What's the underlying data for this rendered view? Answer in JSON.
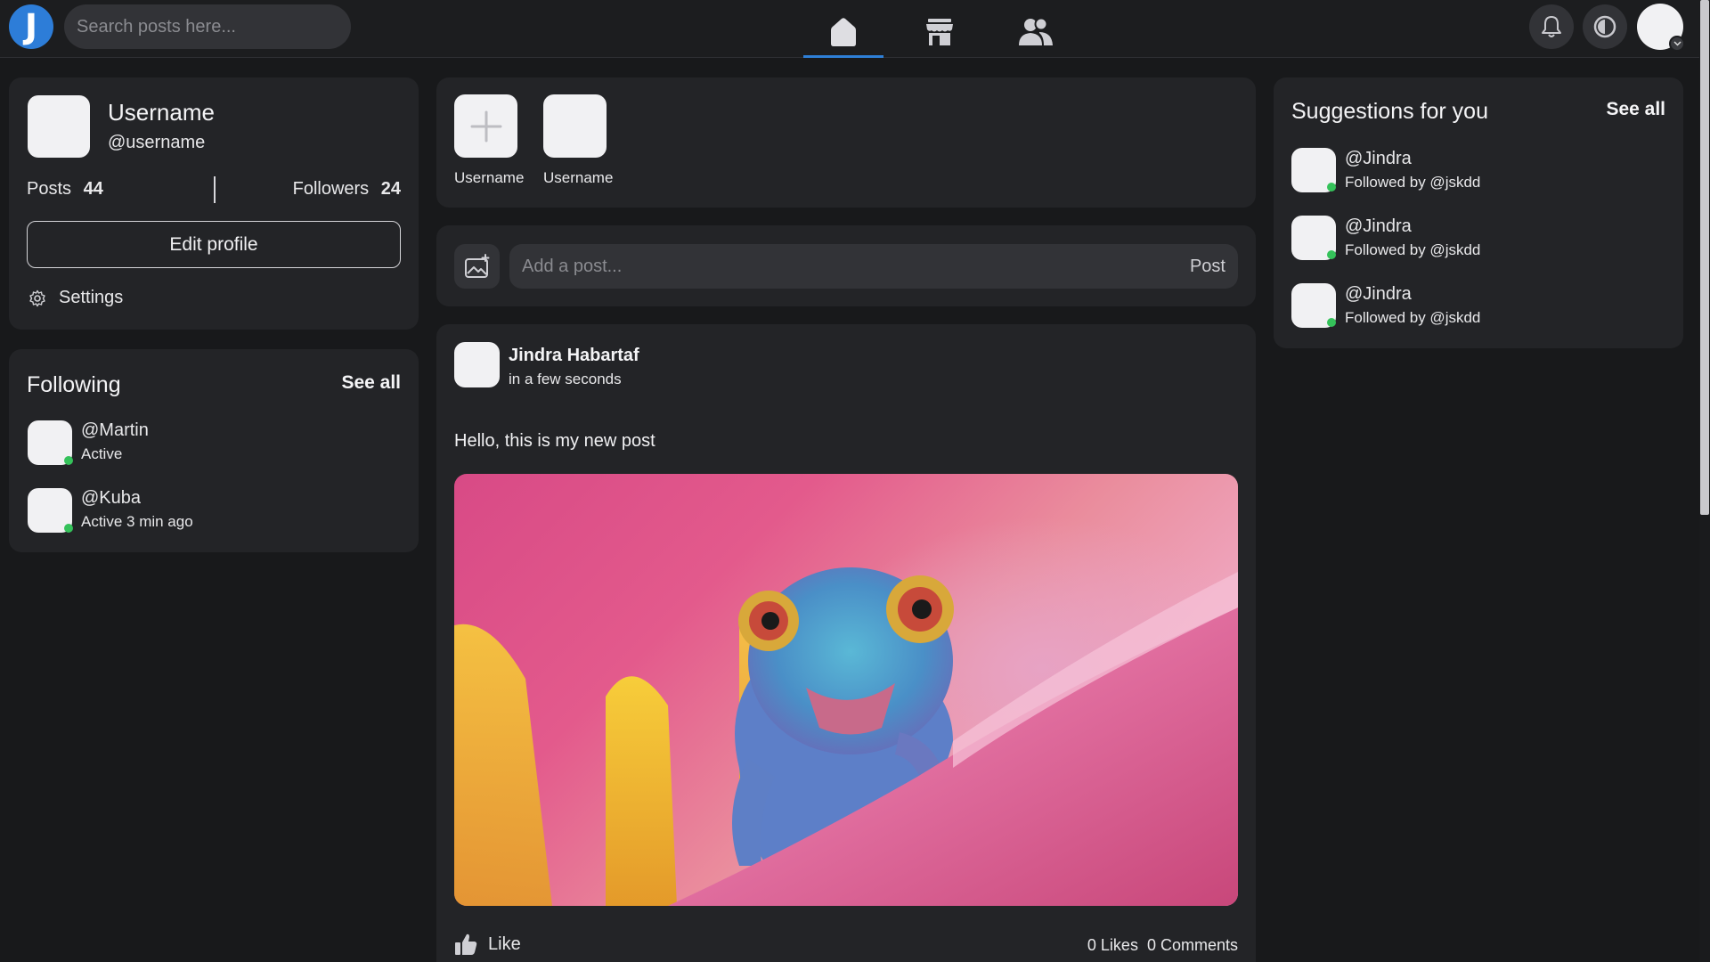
{
  "header": {
    "logo_letter": "J",
    "search_placeholder": "Search posts here...",
    "tabs": [
      {
        "name": "home",
        "icon": "home-icon",
        "active": true
      },
      {
        "name": "marketplace",
        "icon": "store-icon",
        "active": false
      },
      {
        "name": "friends",
        "icon": "people-icon",
        "active": false
      }
    ],
    "icons": [
      "bell-icon",
      "theme-toggle-icon",
      "avatar"
    ]
  },
  "profile": {
    "name": "Username",
    "handle": "@username",
    "posts_label": "Posts",
    "posts_count": "44",
    "followers_label": "Followers",
    "followers_count": "24",
    "edit_label": "Edit profile",
    "settings_label": "Settings"
  },
  "following": {
    "title": "Following",
    "see_all": "See all",
    "items": [
      {
        "handle": "@Martin",
        "status": "Active"
      },
      {
        "handle": "@Kuba",
        "status": "Active 3 min ago"
      }
    ]
  },
  "stories": [
    {
      "label": "Username",
      "add": true
    },
    {
      "label": "Username",
      "add": false
    }
  ],
  "composer": {
    "placeholder": "Add a post...",
    "post_label": "Post"
  },
  "post": {
    "author": "Jindra Habartaf",
    "time": "in a few seconds",
    "text": "Hello, this is my new post",
    "like_label": "Like",
    "likes": "0 Likes",
    "comments": "0 Comments"
  },
  "suggestions": {
    "title": "Suggestions for you",
    "see_all": "See all",
    "items": [
      {
        "handle": "@Jindra",
        "sub": "Followed by @jskdd"
      },
      {
        "handle": "@Jindra",
        "sub": "Followed by @jskdd"
      },
      {
        "handle": "@Jindra",
        "sub": "Followed by @jskdd"
      }
    ]
  },
  "colors": {
    "background": "#18191b",
    "card": "#232427",
    "accent": "#2e7fd6",
    "online": "#35c25a"
  }
}
